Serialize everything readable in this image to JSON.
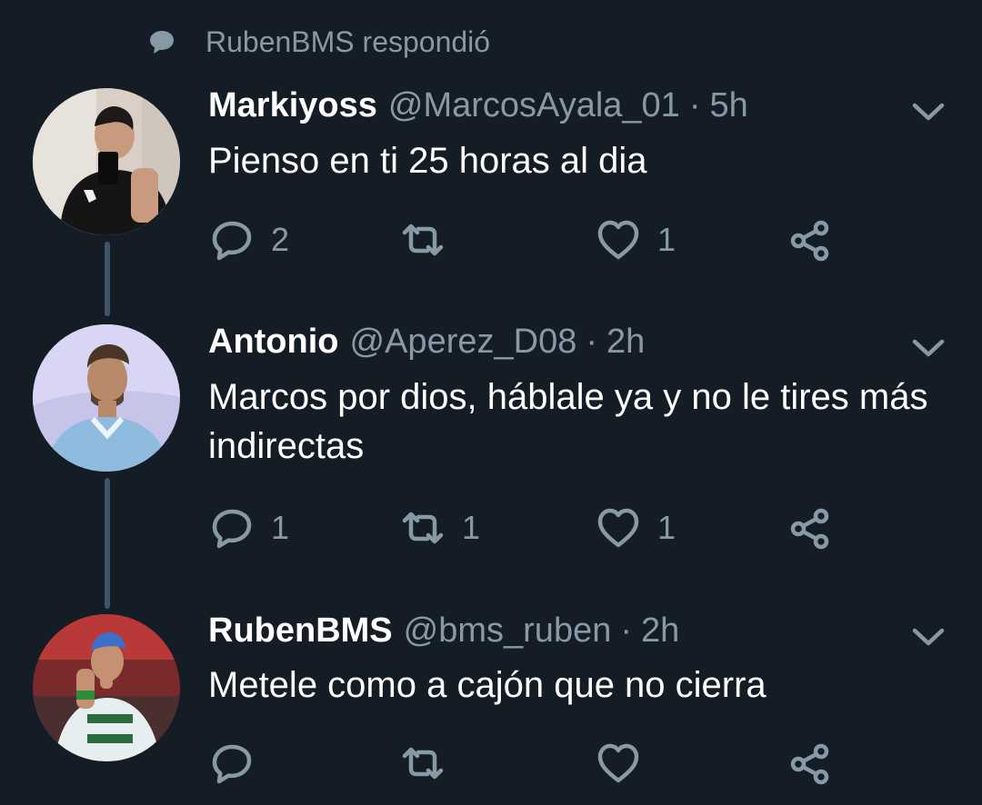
{
  "context": {
    "text": "RubenBMS respondió"
  },
  "tweets": [
    {
      "name": "Markiyoss",
      "handle": "@MarcosAyala_01",
      "time": "5h",
      "text": "Pienso en ti 25 horas al dia",
      "replies": "2",
      "retweets": "",
      "likes": "1"
    },
    {
      "name": "Antonio",
      "handle": "@Aperez_D08",
      "time": "2h",
      "text": "Marcos por dios, háblale ya y no le tires más indirectas",
      "replies": "1",
      "retweets": "1",
      "likes": "1"
    },
    {
      "name": "RubenBMS",
      "handle": "@bms_ruben",
      "time": "2h",
      "text": "Metele como a cajón que no cierra",
      "replies": "",
      "retweets": "",
      "likes": ""
    }
  ],
  "separator": "·",
  "colors": {
    "background": "#141d26",
    "secondary_text": "#8899a6",
    "thread_line": "#3d5466"
  },
  "icons": [
    "speech-bubble-icon",
    "chevron-down-icon",
    "reply-icon",
    "retweet-icon",
    "heart-icon",
    "share-icon"
  ]
}
